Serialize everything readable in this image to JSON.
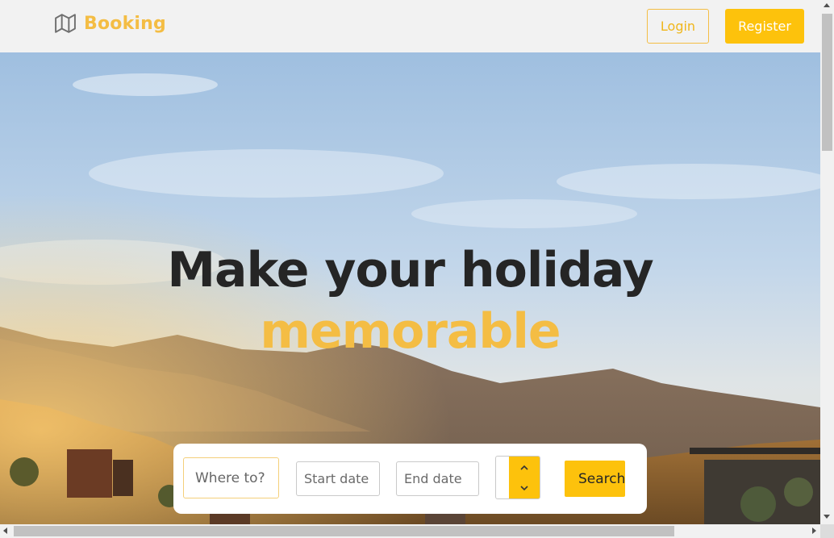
{
  "header": {
    "brand_name": "Booking",
    "brand_icon": "map-icon",
    "login_label": "Login",
    "register_label": "Register"
  },
  "hero": {
    "headline_line1": "Make your holiday",
    "headline_line2": "memorable"
  },
  "search": {
    "where_placeholder": "Where to?",
    "start_placeholder": "Start date",
    "end_placeholder": "End date",
    "guests_value": "",
    "search_label": "Search"
  },
  "colors": {
    "accent": "#fdc20c",
    "brand_text": "#f4bd44",
    "headline": "#252525"
  }
}
